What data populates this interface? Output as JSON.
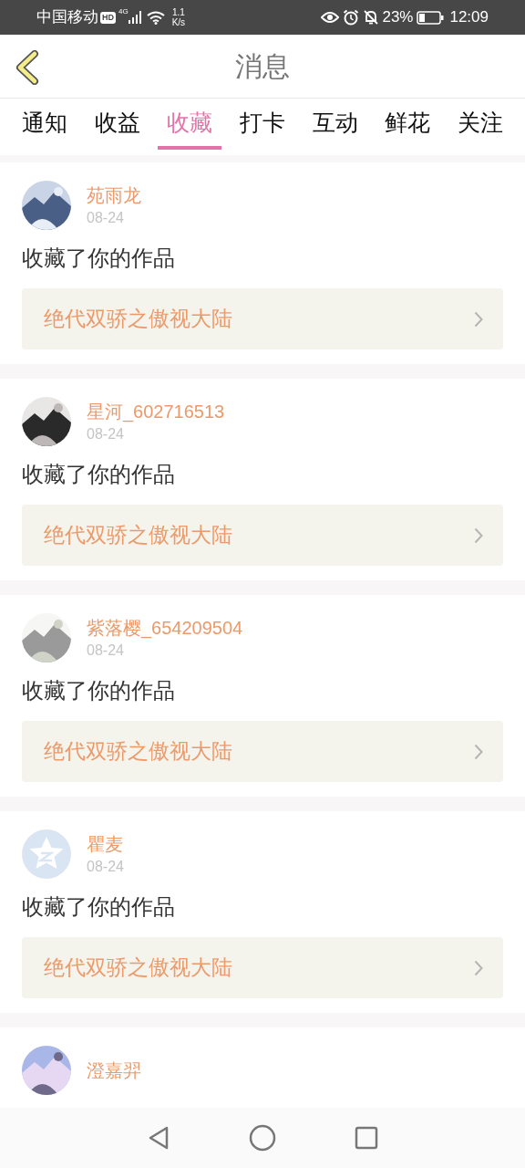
{
  "status_bar": {
    "carrier": "中国移动",
    "hd": "HD",
    "network": "4G",
    "speed": [
      "1.1",
      "K/s"
    ],
    "battery": "23%",
    "time": "12:09"
  },
  "header": {
    "title": "消息"
  },
  "tabs": [
    {
      "label": "通知",
      "selected": false
    },
    {
      "label": "收益",
      "selected": false
    },
    {
      "label": "收藏",
      "selected": true
    },
    {
      "label": "打卡",
      "selected": false
    },
    {
      "label": "互动",
      "selected": false
    },
    {
      "label": "鲜花",
      "selected": false
    },
    {
      "label": "关注",
      "selected": false
    }
  ],
  "messages": [
    {
      "name": "苑雨龙",
      "date": "08-24",
      "action": "收藏了你的作品",
      "work": "绝代双骄之傲视大陆"
    },
    {
      "name": "星河_602716513",
      "date": "08-24",
      "action": "收藏了你的作品",
      "work": "绝代双骄之傲视大陆"
    },
    {
      "name": "紫落樱_654209504",
      "date": "08-24",
      "action": "收藏了你的作品",
      "work": "绝代双骄之傲视大陆"
    },
    {
      "avatar": {
        "kind": "icon"
      },
      "name": "瞿麦",
      "date": "08-24",
      "action": "收藏了你的作品",
      "work": "绝代双骄之傲视大陆"
    },
    {
      "name": "澄嘉羿"
    }
  ]
}
